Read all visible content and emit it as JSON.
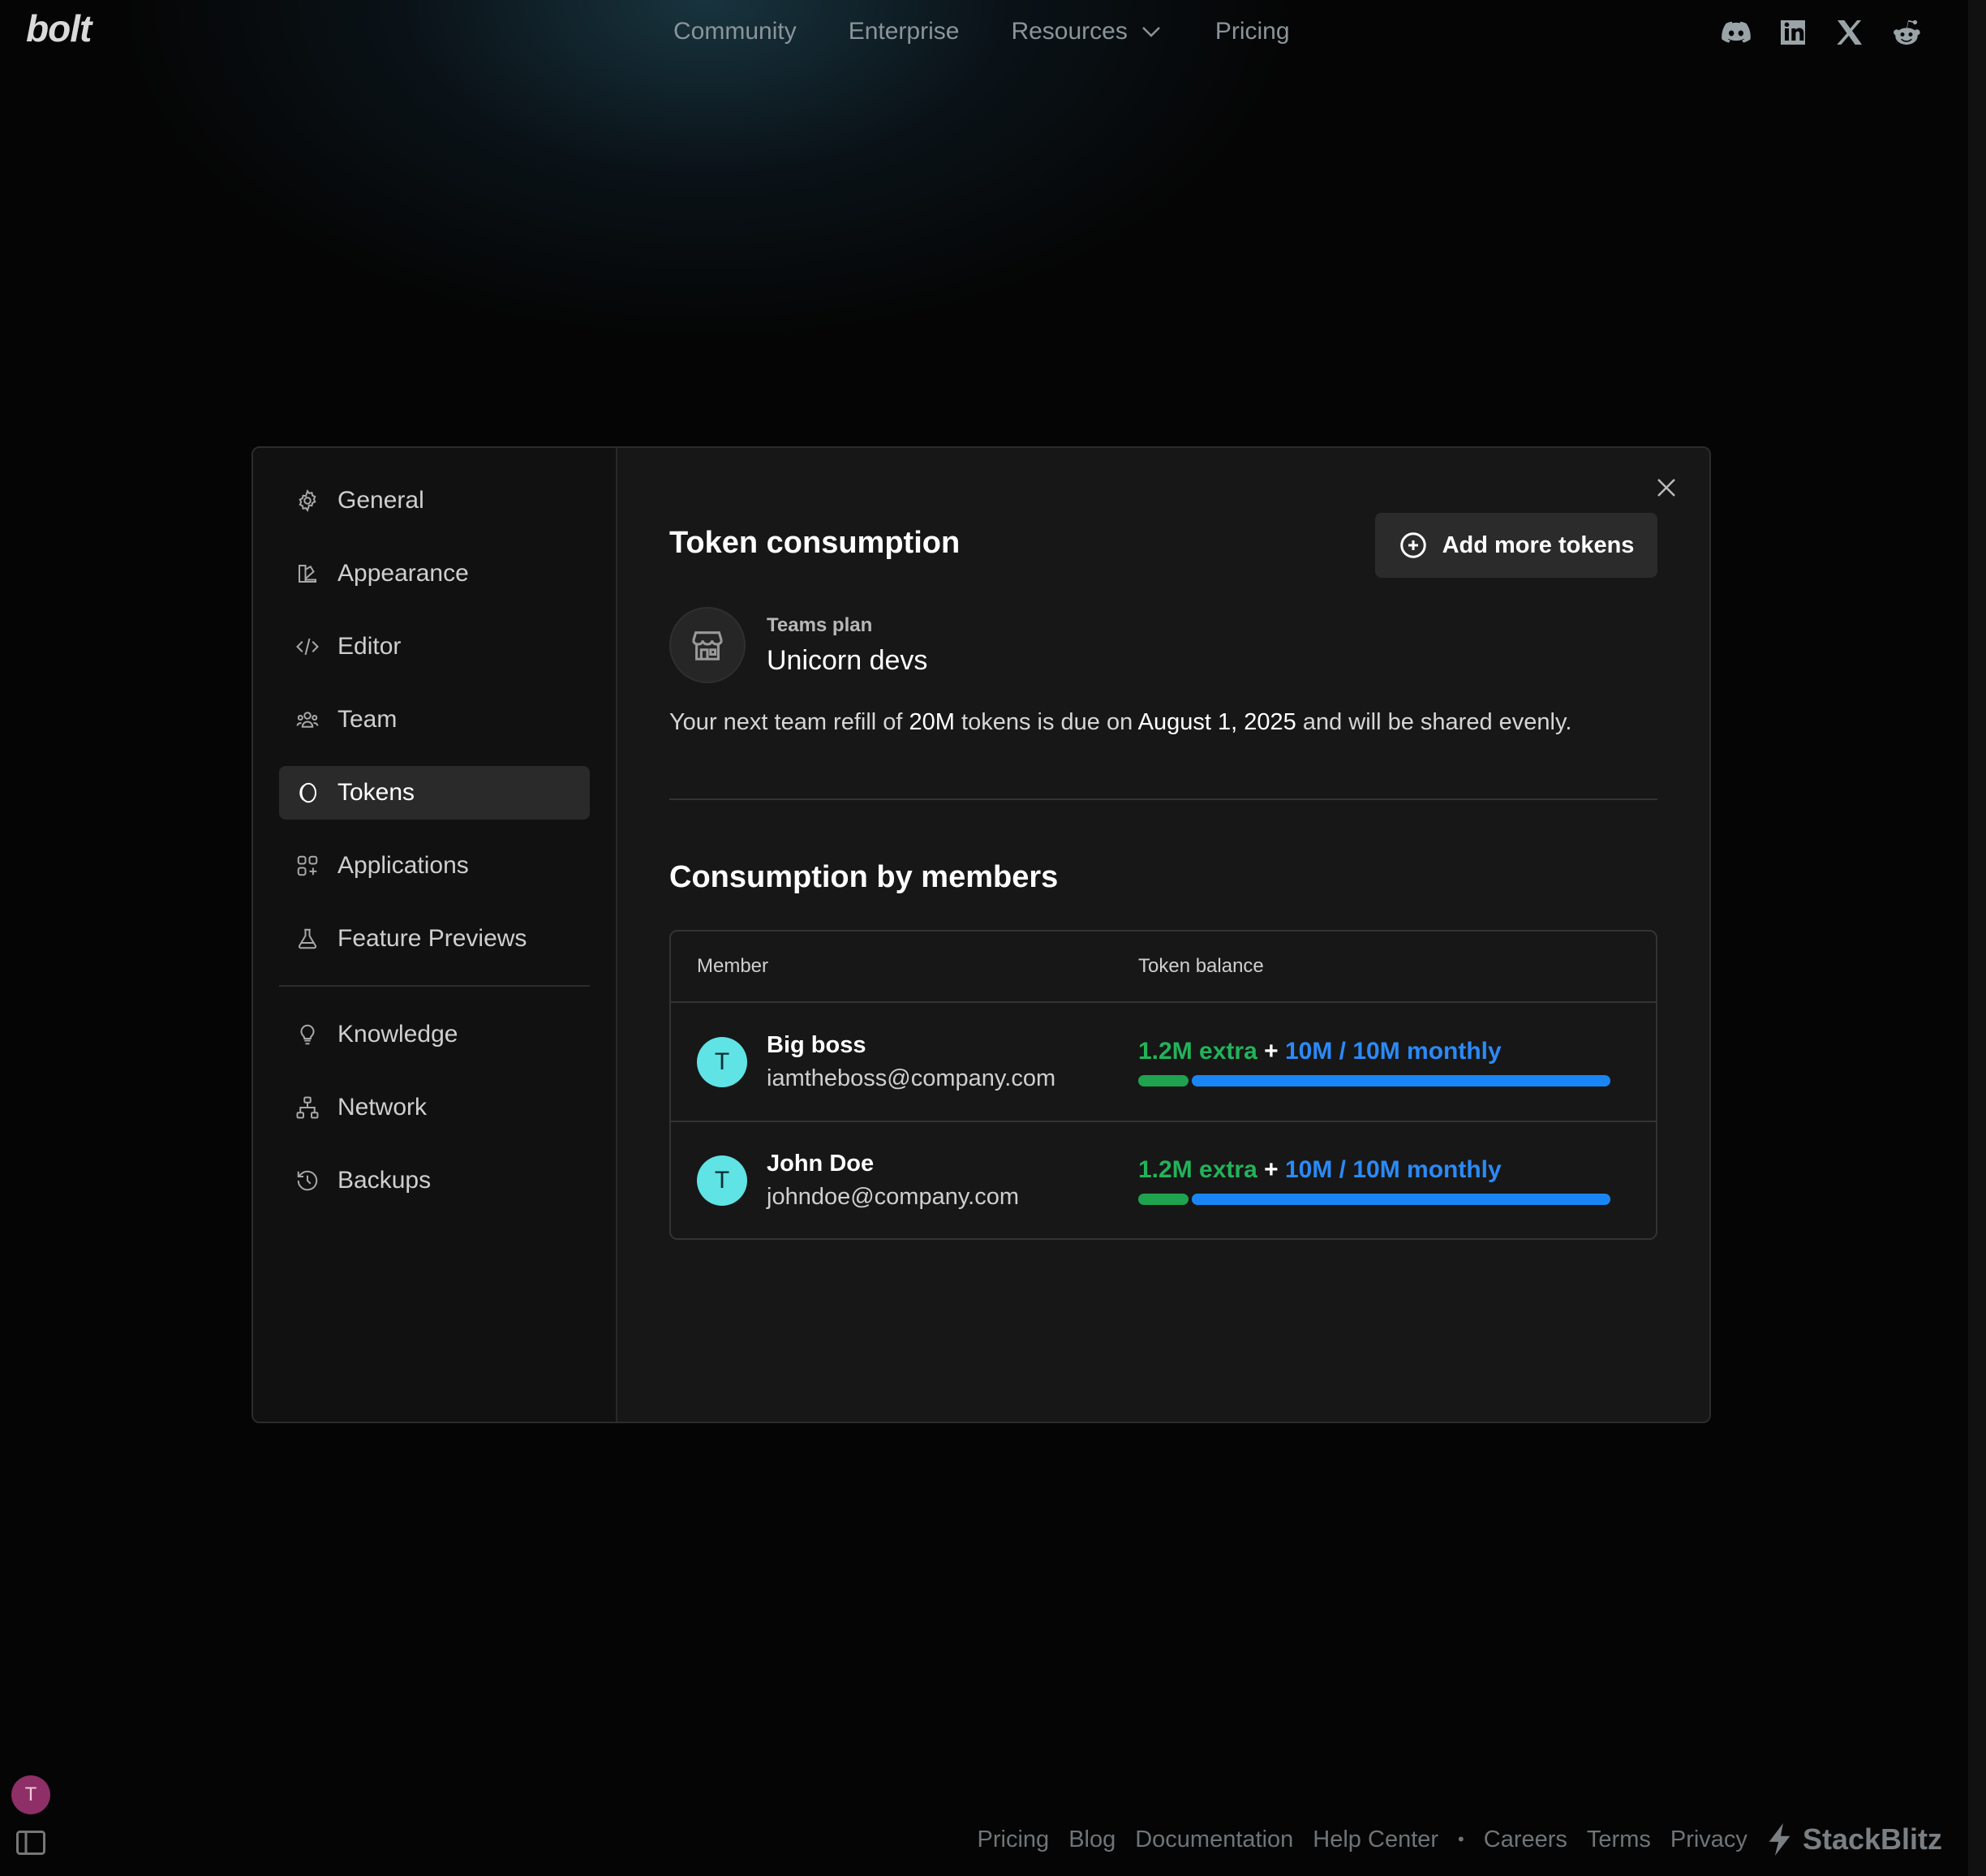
{
  "nav": {
    "logo": "bolt",
    "links": [
      "Community",
      "Enterprise",
      "Resources",
      "Pricing"
    ]
  },
  "socials": [
    "discord-icon",
    "linkedin-icon",
    "x-icon",
    "reddit-icon"
  ],
  "sidebar": {
    "items": [
      {
        "label": "General",
        "icon": "gear-icon"
      },
      {
        "label": "Appearance",
        "icon": "appearance-icon"
      },
      {
        "label": "Editor",
        "icon": "code-icon"
      },
      {
        "label": "Team",
        "icon": "team-icon"
      },
      {
        "label": "Tokens",
        "icon": "coin-icon",
        "active": true
      },
      {
        "label": "Applications",
        "icon": "apps-icon"
      },
      {
        "label": "Feature Previews",
        "icon": "flask-icon"
      }
    ],
    "items2": [
      {
        "label": "Knowledge",
        "icon": "lightbulb-icon"
      },
      {
        "label": "Network",
        "icon": "network-icon"
      },
      {
        "label": "Backups",
        "icon": "history-icon"
      }
    ]
  },
  "main": {
    "title": "Token consumption",
    "add_button": "Add more tokens",
    "plan_label": "Teams plan",
    "plan_name": "Unicorn devs",
    "refill_prefix": "Your next team refill of ",
    "refill_amount": "20M",
    "refill_mid": " tokens is due on ",
    "refill_date": "August 1, 2025",
    "refill_suffix": " and will be shared evenly.",
    "members_title": "Consumption by members",
    "table": {
      "col_member": "Member",
      "col_balance": "Token balance",
      "rows": [
        {
          "initial": "T",
          "name": "Big boss",
          "email": "iamtheboss@company.com",
          "extra": "1.2M extra",
          "plus": "+",
          "monthly": "10M / 10M monthly",
          "extra_fraction": 0.107,
          "monthly_fraction": 0.893
        },
        {
          "initial": "T",
          "name": "John Doe",
          "email": "johndoe@company.com",
          "extra": "1.2M extra",
          "plus": "+",
          "monthly": "10M / 10M monthly",
          "extra_fraction": 0.107,
          "monthly_fraction": 0.893
        }
      ]
    }
  },
  "user": {
    "initial": "T"
  },
  "footer": {
    "links": [
      "Pricing",
      "Blog",
      "Documentation",
      "Help Center"
    ],
    "separator": "•",
    "links2": [
      "Careers",
      "Terms",
      "Privacy"
    ],
    "brand": "StackBlitz"
  },
  "colors": {
    "extra": "#22b35a",
    "monthly": "#2b8af7",
    "avatar": "#5fe3e4",
    "user_avatar": "#8e2f67"
  }
}
